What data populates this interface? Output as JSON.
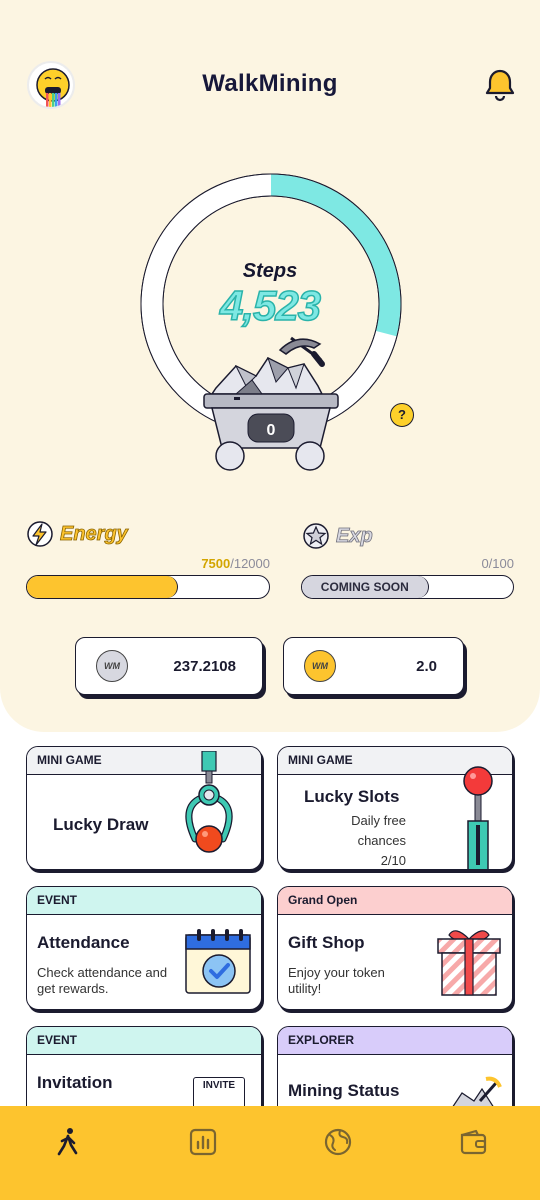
{
  "app": {
    "title": "WalkMining"
  },
  "steps": {
    "label": "Steps",
    "value": "4,523",
    "ring_progress": 0.29
  },
  "cart": {
    "count": "0"
  },
  "help": {
    "label": "?"
  },
  "energy": {
    "label": "Energy",
    "current": "7500",
    "max": "/12000",
    "fill_fraction": 0.625
  },
  "exp": {
    "label": "Exp",
    "value": "0/100",
    "bar_text": "COMING SOON"
  },
  "balances": [
    {
      "coin_icon": "wm-silver-coin-icon",
      "coin_text": "WM",
      "value": "237.2108"
    },
    {
      "coin_icon": "wm-gold-coin-icon",
      "coin_text": "WM",
      "value": "2.0"
    }
  ],
  "cards": {
    "lucky_draw": {
      "tag": "MINI GAME",
      "title": "Lucky Draw",
      "icon": "claw-machine-icon"
    },
    "lucky_slots": {
      "tag": "MINI GAME",
      "title": "Lucky Slots",
      "desc_line1": "Daily free",
      "desc_line2": "chances",
      "desc_line3": "2/10",
      "icon": "slot-lever-icon"
    },
    "attendance": {
      "tag": "EVENT",
      "title": "Attendance",
      "desc": "Check attendance and get rewards.",
      "icon": "calendar-check-icon"
    },
    "gift_shop": {
      "tag": "Grand Open",
      "title": "Gift Shop",
      "desc": "Enjoy your token utility!",
      "icon": "gift-box-icon"
    },
    "invitation": {
      "tag": "EVENT",
      "title": "Invitation",
      "art_text": "INVITE",
      "icon": "invite-card-icon"
    },
    "mining_status": {
      "tag": "EXPLORER",
      "title": "Mining Status",
      "icon": "pickaxe-rocks-icon"
    }
  },
  "nav": [
    {
      "name": "walk",
      "icon": "walking-person-icon",
      "active": true
    },
    {
      "name": "stats",
      "icon": "bar-chart-icon",
      "active": false
    },
    {
      "name": "explore",
      "icon": "globe-icon",
      "active": false
    },
    {
      "name": "wallet",
      "icon": "wallet-icon",
      "active": false
    }
  ],
  "colors": {
    "accent_yellow": "#fdc42e",
    "accent_cyan": "#7ee8e3",
    "panel": "#fcf5e2",
    "ink": "#1b1b2f"
  }
}
